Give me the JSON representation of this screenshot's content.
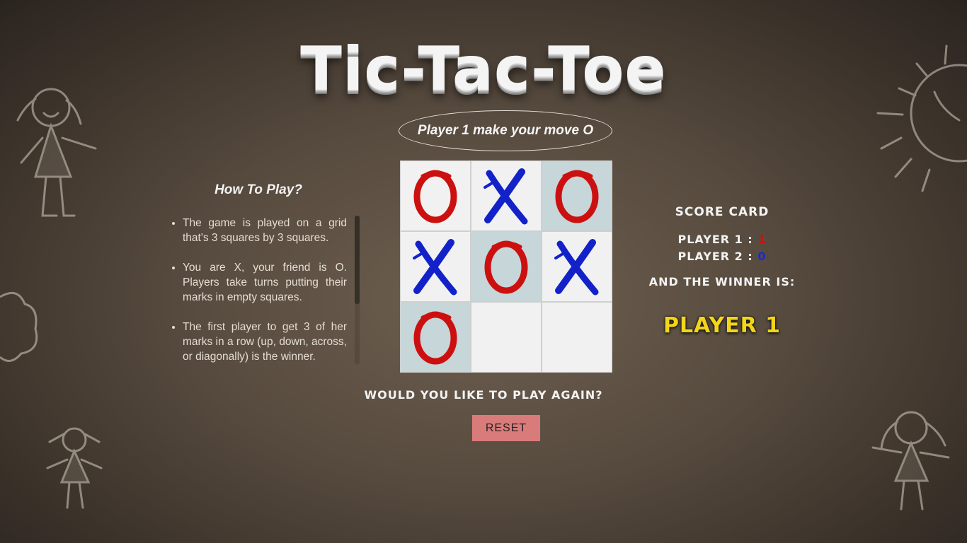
{
  "title": "Tic-Tac-Toe",
  "status": "Player 1 make your move O",
  "board": [
    {
      "mark": "O",
      "highlight": false
    },
    {
      "mark": "X",
      "highlight": false
    },
    {
      "mark": "O",
      "highlight": true
    },
    {
      "mark": "X",
      "highlight": false
    },
    {
      "mark": "O",
      "highlight": true
    },
    {
      "mark": "X",
      "highlight": false
    },
    {
      "mark": "O",
      "highlight": true
    },
    {
      "mark": "",
      "highlight": false
    },
    {
      "mark": "",
      "highlight": false
    }
  ],
  "colors": {
    "o_mark": "#cc1010",
    "x_mark": "#1322c8",
    "win_cell": "#c6d6d9",
    "winner_text": "#f3d51a",
    "reset_button": "#d97b7b"
  },
  "how_to": {
    "title": "How To Play?",
    "items": [
      "The game is played on a grid that's 3 squares by 3 squares.",
      "You are X, your friend is O. Players take turns putting their marks in empty squares.",
      "The first player to get 3 of her marks in a row (up, down, across, or diagonally) is the winner."
    ]
  },
  "score_card": {
    "title": "SCORE CARD",
    "player1_label": "PLAYER 1 :",
    "player1_score": "1",
    "player2_label": "PLAYER 2 :",
    "player2_score": "0",
    "winner_label": "AND THE WINNER IS:",
    "winner": "PLAYER 1"
  },
  "play_again": "WOULD YOU LIKE TO PLAY AGAIN?",
  "reset_label": "RESET"
}
